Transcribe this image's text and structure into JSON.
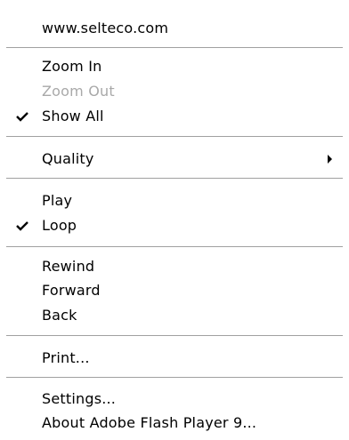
{
  "menu": {
    "website": "www.selteco.com",
    "zoom_in": "Zoom In",
    "zoom_out": "Zoom Out",
    "show_all": "Show All",
    "quality": "Quality",
    "play": "Play",
    "loop": "Loop",
    "rewind": "Rewind",
    "forward": "Forward",
    "back": "Back",
    "print": "Print...",
    "settings": "Settings...",
    "about": "About Adobe Flash Player 9..."
  },
  "state": {
    "show_all_checked": true,
    "loop_checked": true,
    "zoom_out_enabled": false
  },
  "icons": {
    "check": "check-icon",
    "submenu": "submenu-arrow-icon"
  },
  "colors": {
    "disabled_text": "#a9a9a9",
    "separator": "#a0a0a0"
  }
}
